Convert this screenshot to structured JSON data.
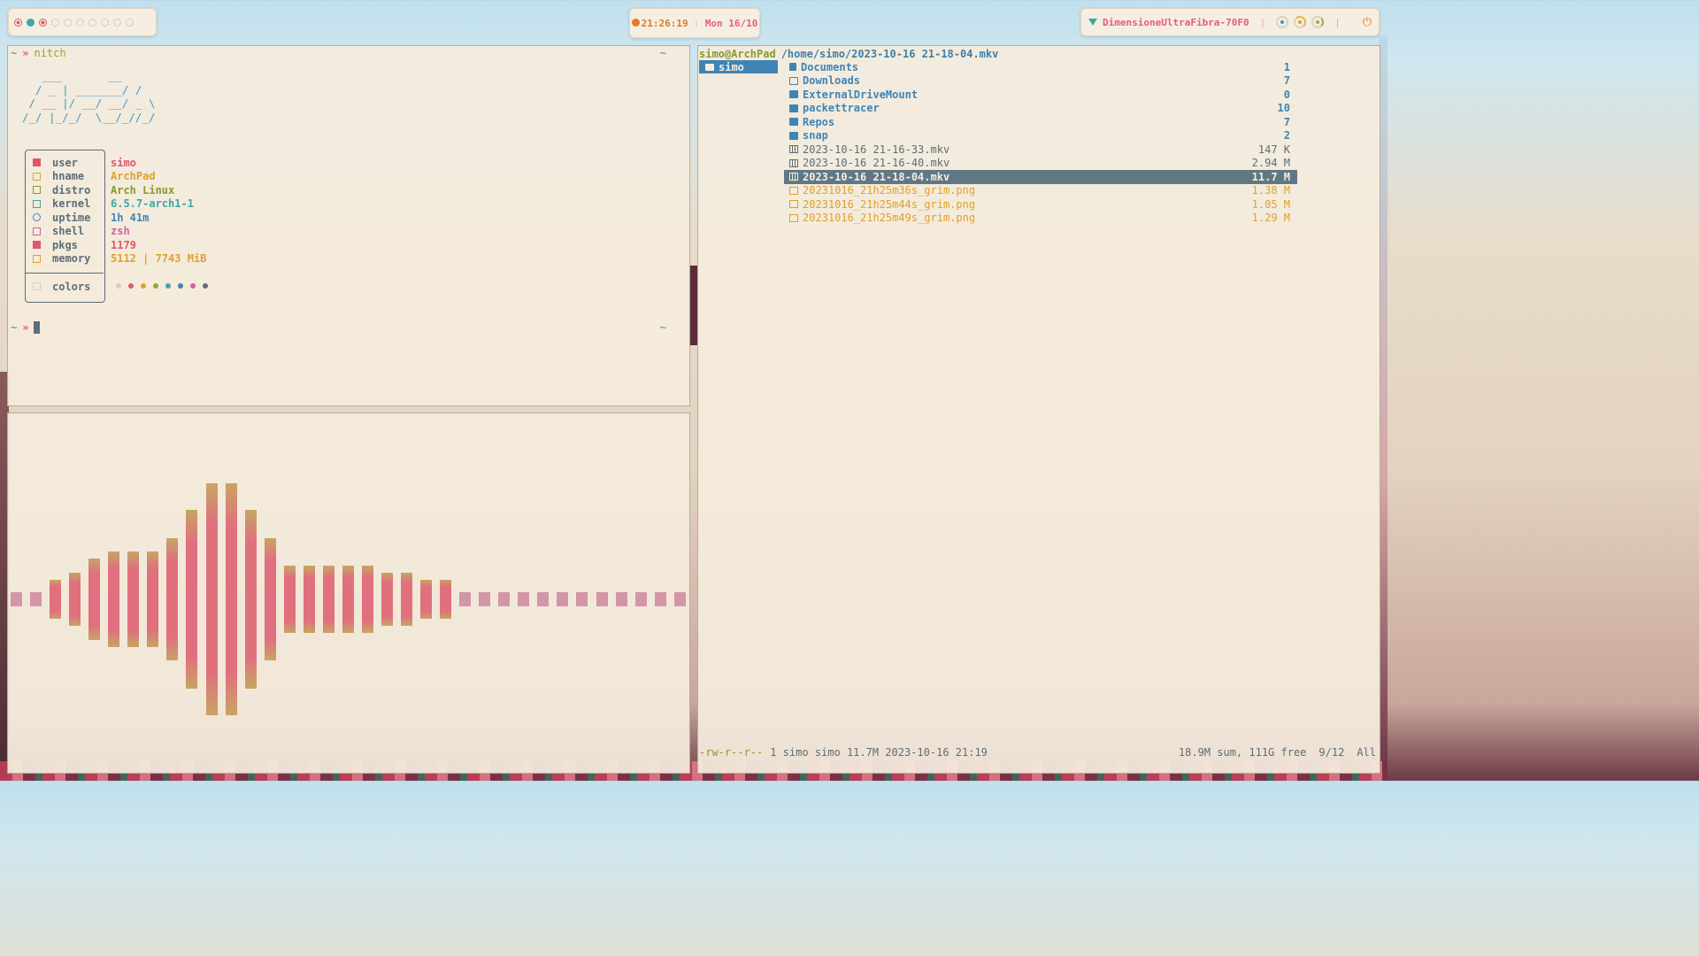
{
  "topbar": {
    "workspaces": [
      {
        "state": "close"
      },
      {
        "state": "active"
      },
      {
        "state": "urgent"
      },
      {
        "state": "empty"
      },
      {
        "state": "empty"
      },
      {
        "state": "empty"
      },
      {
        "state": "empty"
      },
      {
        "state": "empty"
      },
      {
        "state": "empty"
      },
      {
        "state": "empty"
      }
    ],
    "clock": {
      "time": "21:26:19",
      "date": "Mon 16/10"
    },
    "network": {
      "ssid": "DimensioneUltraFibra-70F0",
      "icon": "wifi-icon"
    },
    "power_icon": "⏻"
  },
  "terminal": {
    "prompt_tilde": "~",
    "prompt_arrow": "»",
    "command": "nitch",
    "right_tilde": "~",
    "ascii_art": "   ___       __\n  / _ | _______/ /\n / __ |/ __/ __/ _ \\\n/_/ |_/_/  \\__/_//_/",
    "info": [
      {
        "key": "user",
        "value": "simo",
        "color": "#e0566b",
        "icon": "user-icon"
      },
      {
        "key": "hname",
        "value": "ArchPad",
        "color": "#e0a12c",
        "icon": "host-icon"
      },
      {
        "key": "distro",
        "value": "Arch Linux",
        "color": "#8a9a2c",
        "icon": "distro-icon"
      },
      {
        "key": "kernel",
        "value": "6.5.7-arch1-1",
        "color": "#3fa7a5",
        "icon": "kernel-icon"
      },
      {
        "key": "uptime",
        "value": "1h 41m",
        "color": "#3f84b5",
        "icon": "clock-icon"
      },
      {
        "key": "shell",
        "value": "zsh",
        "color": "#d65fa5",
        "icon": "shell-icon"
      },
      {
        "key": "pkgs",
        "value": "1179",
        "color": "#e0566b",
        "icon": "package-icon"
      },
      {
        "key": "memory",
        "value": "5112 | 7743 MiB",
        "color": "#e0a12c",
        "icon": "memory-icon"
      }
    ],
    "colors_label": "colors",
    "color_swatches": [
      "#d8cfc2",
      "#e0566b",
      "#e0a12c",
      "#96a532",
      "#3fa7a5",
      "#3f84b5",
      "#d65fa5",
      "#5d6d77"
    ]
  },
  "visualizer": {
    "levels": [
      0.06,
      0.06,
      0.17,
      0.23,
      0.35,
      0.41,
      0.41,
      0.41,
      0.53,
      0.77,
      1.0,
      1.0,
      0.77,
      0.53,
      0.29,
      0.29,
      0.29,
      0.29,
      0.29,
      0.23,
      0.23,
      0.17,
      0.17,
      0.06,
      0.06,
      0.06,
      0.06,
      0.06,
      0.06,
      0.06,
      0.06,
      0.06,
      0.06,
      0.06,
      0.06
    ]
  },
  "filemanager": {
    "user_host": "simo@ArchPad",
    "path": "/home/simo/2023-10-16 21-18-04.mkv",
    "parent": {
      "name": "simo"
    },
    "files": [
      {
        "name": "Documents",
        "size": "1",
        "kind": "doc"
      },
      {
        "name": "Downloads",
        "size": "7",
        "kind": "dl"
      },
      {
        "name": "ExternalDriveMount",
        "size": "0",
        "kind": "dir"
      },
      {
        "name": "packettracer",
        "size": "10",
        "kind": "dir"
      },
      {
        "name": "Repos",
        "size": "7",
        "kind": "dir"
      },
      {
        "name": "snap",
        "size": "2",
        "kind": "dir"
      },
      {
        "name": "2023-10-16 21-16-33.mkv",
        "size": "147 K",
        "kind": "video"
      },
      {
        "name": "2023-10-16 21-16-40.mkv",
        "size": "2.94 M",
        "kind": "video"
      },
      {
        "name": "2023-10-16 21-18-04.mkv",
        "size": "11.7 M",
        "kind": "video",
        "selected": true
      },
      {
        "name": "20231016_21h25m36s_grim.png",
        "size": "1.38 M",
        "kind": "image"
      },
      {
        "name": "20231016_21h25m44s_grim.png",
        "size": "1.05 M",
        "kind": "image"
      },
      {
        "name": "20231016_21h25m49s_grim.png",
        "size": "1.29 M",
        "kind": "image"
      }
    ],
    "status": {
      "perms": "-rw-r--r--",
      "info": "1 simo simo 11.7M 2023-10-16 21:19",
      "summary": "18.9M sum, 111G free",
      "position": "9/12",
      "scroll": "All"
    }
  }
}
